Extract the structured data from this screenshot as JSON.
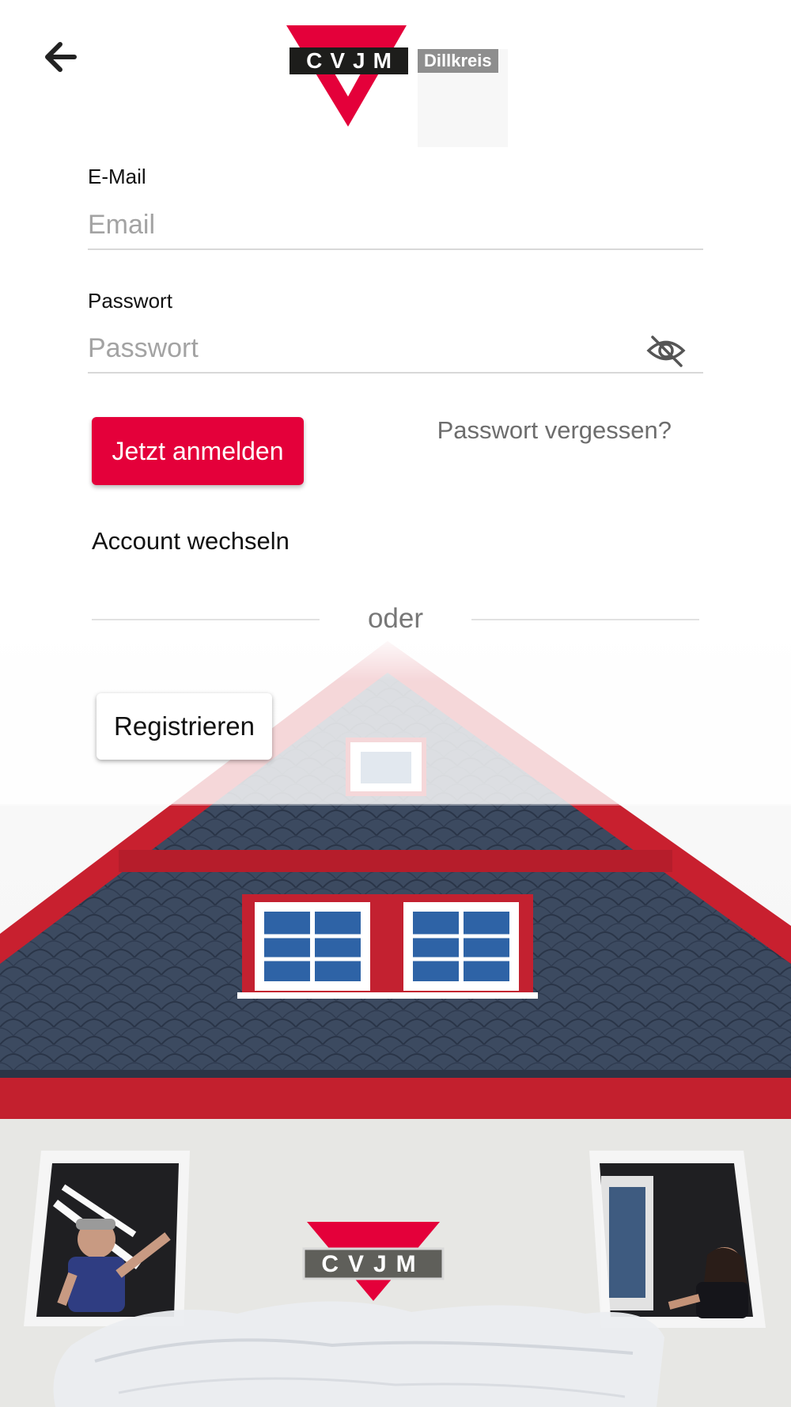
{
  "header": {
    "back_icon": "arrow-left-icon",
    "logo": {
      "wordmark": "CVJM",
      "region": "Dillkreis",
      "brand_red": "#e4003a"
    }
  },
  "login_form": {
    "email": {
      "label": "E-Mail",
      "placeholder": "Email",
      "value": ""
    },
    "password": {
      "label": "Passwort",
      "placeholder": "Passwort",
      "value": "",
      "visibility_icon": "eye-off-icon"
    },
    "login_button": "Jetzt anmelden",
    "forgot_link": "Passwort vergessen?",
    "switch_account": "Account wechseln",
    "divider_text": "oder",
    "register_button": "Registrieren"
  },
  "background": {
    "building_sign": "CVJM",
    "colors": {
      "roof_slate": "#3a475c",
      "trim_red": "#c8202f",
      "wall": "#e6e6e3"
    }
  }
}
